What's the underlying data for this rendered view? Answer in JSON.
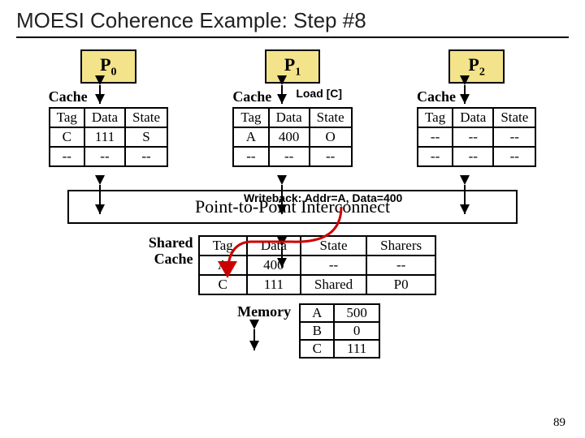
{
  "title": "MOESI Coherence Example: Step #8",
  "processors": [
    "P",
    "P",
    "P"
  ],
  "proc_subs": [
    "0",
    "1",
    "2"
  ],
  "cache_label": "Cache",
  "cache_headers": [
    "Tag",
    "Data",
    "State"
  ],
  "caches": [
    [
      [
        "C",
        "111",
        "S"
      ],
      [
        "--",
        "--",
        "--"
      ]
    ],
    [
      [
        "A",
        "400",
        "O"
      ],
      [
        "--",
        "--",
        "--"
      ]
    ],
    [
      [
        "--",
        "--",
        "--"
      ],
      [
        "--",
        "--",
        "--"
      ]
    ]
  ],
  "load_annot": "Load [C]",
  "writeback": "Writeback: Addr=A, Data=400",
  "interconnect": "Point-to-Point Interconnect",
  "shared_label_1": "Shared",
  "shared_label_2": "Cache",
  "shared_headers": [
    "Tag",
    "Data",
    "State",
    "Sharers"
  ],
  "shared_rows": [
    [
      "A",
      "400",
      "--",
      "--"
    ],
    [
      "C",
      "111",
      "Shared",
      "P0"
    ]
  ],
  "memory_label": "Memory",
  "memory_rows": [
    [
      "A",
      "500"
    ],
    [
      "B",
      "0"
    ],
    [
      "C",
      "111"
    ]
  ],
  "slide_number": "89"
}
